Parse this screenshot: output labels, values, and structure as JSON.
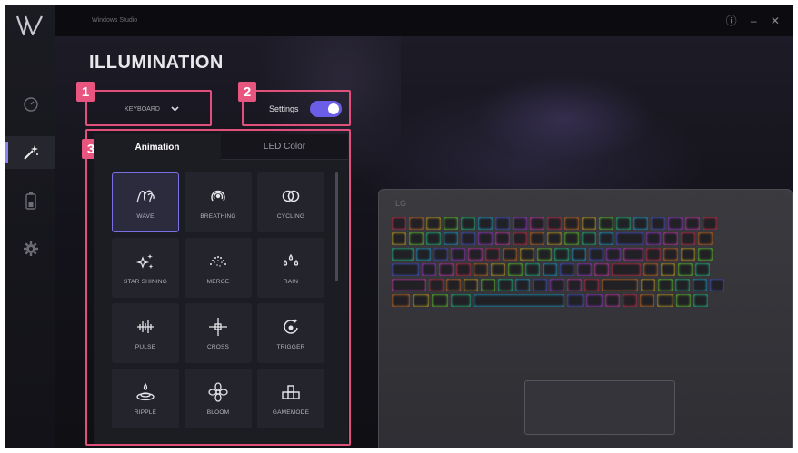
{
  "app": {
    "title": "Windows Studio",
    "window_controls": "ⓘ – ✕"
  },
  "page": {
    "title": "ILLUMINATION"
  },
  "nav": [
    {
      "name": "dashboard",
      "icon": "speedometer-icon"
    },
    {
      "name": "illumination",
      "icon": "magic-wand-icon",
      "active": true
    },
    {
      "name": "battery",
      "icon": "battery-icon"
    },
    {
      "name": "settings",
      "icon": "gear-icon"
    }
  ],
  "device_select": {
    "value": "KEYBOARD"
  },
  "settings_toggle": {
    "label": "Settings",
    "on": true
  },
  "tabs": [
    {
      "label": "Animation",
      "active": true
    },
    {
      "label": "LED Color",
      "active": false
    }
  ],
  "effects": [
    {
      "label": "WAVE",
      "icon": "wave-icon",
      "active": true
    },
    {
      "label": "BREATHING",
      "icon": "breathing-icon"
    },
    {
      "label": "CYCLING",
      "icon": "cycling-icon"
    },
    {
      "label": "STAR SHINING",
      "icon": "star-shining-icon"
    },
    {
      "label": "MERGE",
      "icon": "merge-icon"
    },
    {
      "label": "RAIN",
      "icon": "rain-icon"
    },
    {
      "label": "PULSE",
      "icon": "pulse-icon"
    },
    {
      "label": "CROSS",
      "icon": "cross-icon"
    },
    {
      "label": "TRIGGER",
      "icon": "trigger-icon"
    },
    {
      "label": "RIPPLE",
      "icon": "ripple-icon"
    },
    {
      "label": "BLOOM",
      "icon": "bloom-icon"
    },
    {
      "label": "GAMEMODE",
      "icon": "gamemode-icon"
    }
  ],
  "annotations": [
    "1",
    "2",
    "3"
  ],
  "laptop": {
    "logo": "LG"
  },
  "colors": {
    "accent": "#6a5ee8",
    "annotation": "#e0507a"
  }
}
